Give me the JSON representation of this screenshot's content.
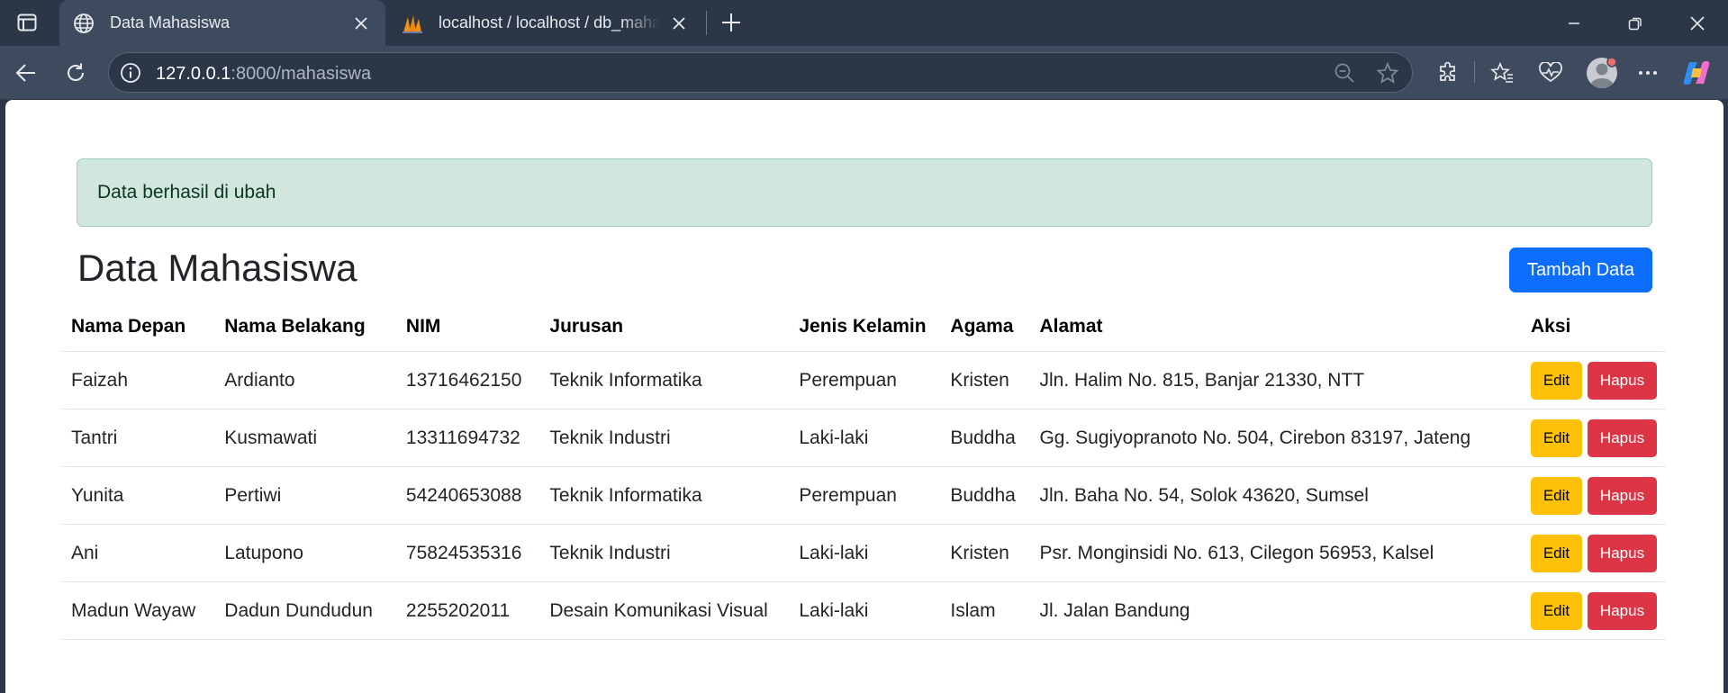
{
  "browser": {
    "tabs": [
      {
        "title": "Data Mahasiswa",
        "icon": "globe-icon",
        "active": true
      },
      {
        "title": "localhost / localhost / db_mahasiswa",
        "icon": "phpmyadmin-icon",
        "active": false
      }
    ],
    "url_host": "127.0.0.1",
    "url_path": ":8000/mahasiswa"
  },
  "alert": {
    "message": "Data berhasil di ubah",
    "color": "#d1e7dd"
  },
  "page": {
    "title": "Data Mahasiswa",
    "add_button_label": "Tambah Data"
  },
  "table": {
    "headers": [
      "Nama Depan",
      "Nama Belakang",
      "NIM",
      "Jurusan",
      "Jenis Kelamin",
      "Agama",
      "Alamat",
      "Aksi"
    ],
    "rows": [
      {
        "nama_depan": "Faizah",
        "nama_belakang": "Ardianto",
        "nim": "13716462150",
        "jurusan": "Teknik Informatika",
        "jenis_kelamin": "Perempuan",
        "agama": "Kristen",
        "alamat": "Jln. Halim No. 815, Banjar 21330, NTT"
      },
      {
        "nama_depan": "Tantri",
        "nama_belakang": "Kusmawati",
        "nim": "13311694732",
        "jurusan": "Teknik Industri",
        "jenis_kelamin": "Laki-laki",
        "agama": "Buddha",
        "alamat": "Gg. Sugiyopranoto No. 504, Cirebon 83197, Jateng"
      },
      {
        "nama_depan": "Yunita",
        "nama_belakang": "Pertiwi",
        "nim": "54240653088",
        "jurusan": "Teknik Informatika",
        "jenis_kelamin": "Perempuan",
        "agama": "Buddha",
        "alamat": "Jln. Baha No. 54, Solok 43620, Sumsel"
      },
      {
        "nama_depan": "Ani",
        "nama_belakang": "Latupono",
        "nim": "75824535316",
        "jurusan": "Teknik Industri",
        "jenis_kelamin": "Laki-laki",
        "agama": "Kristen",
        "alamat": "Psr. Monginsidi No. 613, Cilegon 56953, Kalsel"
      },
      {
        "nama_depan": "Madun Wayaw",
        "nama_belakang": "Dadun Dundudun",
        "nim": "2255202011",
        "jurusan": "Desain Komunikasi Visual",
        "jenis_kelamin": "Laki-laki",
        "agama": "Islam",
        "alamat": "Jl. Jalan Bandung"
      }
    ],
    "edit_label": "Edit",
    "delete_label": "Hapus"
  },
  "colors": {
    "primary": "#0d6efd",
    "warning": "#ffc107",
    "danger": "#dc3545",
    "chrome": "#2b3647"
  }
}
